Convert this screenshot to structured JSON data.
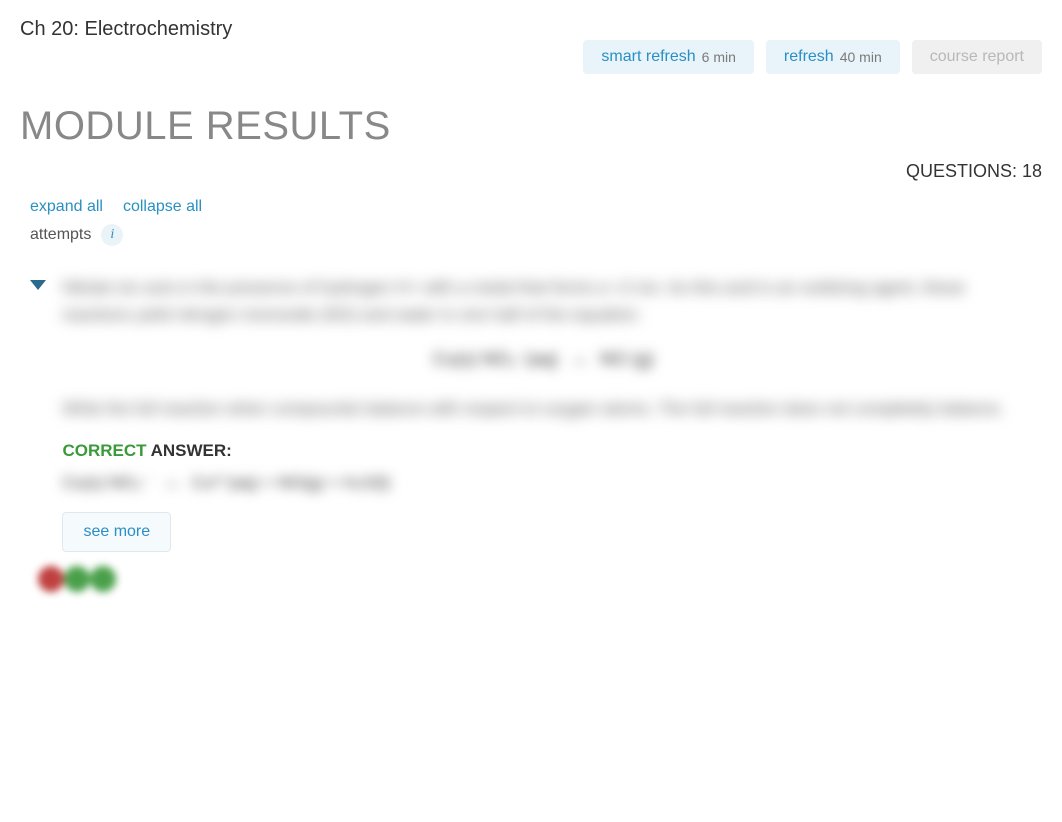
{
  "header": {
    "chapter_title": "Ch 20: Electrochemistry"
  },
  "actions": {
    "smart_refresh_label": "smart refresh",
    "smart_refresh_time": "6 min",
    "refresh_label": "refresh",
    "refresh_time": "40 min",
    "course_report_label": "course report"
  },
  "module": {
    "heading": "MODULE RESULTS",
    "questions_label": "QUESTIONS:",
    "questions_count": "18"
  },
  "controls": {
    "expand_all": "expand all",
    "collapse_all": "collapse all",
    "attempts_label": "attempts",
    "info_icon": "i"
  },
  "question": {
    "prompt_line1": "Nitrate ion acts in the presence of hydrogen H+ with a metal that forms a +2 ion. As this acid is an oxidizing agent, these reactions yield",
    "prompt_line2": "nitrogen monoxide (NO) and water in one half of the equation.",
    "formula_left": "Cu(s) NO₃⁻(aq)",
    "formula_right": "NO (g)",
    "prompt_line3": "Write the full reaction when compounds balance with respect to oxygen atoms. The full reaction does not",
    "prompt_line4": "completely balance.",
    "correct_label": "CORRECT",
    "answer_label": " ANSWER:",
    "answer_text_left": "Cu(s) NO₃⁻",
    "answer_text_right": "Cu²⁺(aq) + NO(g) + H₂O(l)",
    "see_more": "see more"
  }
}
